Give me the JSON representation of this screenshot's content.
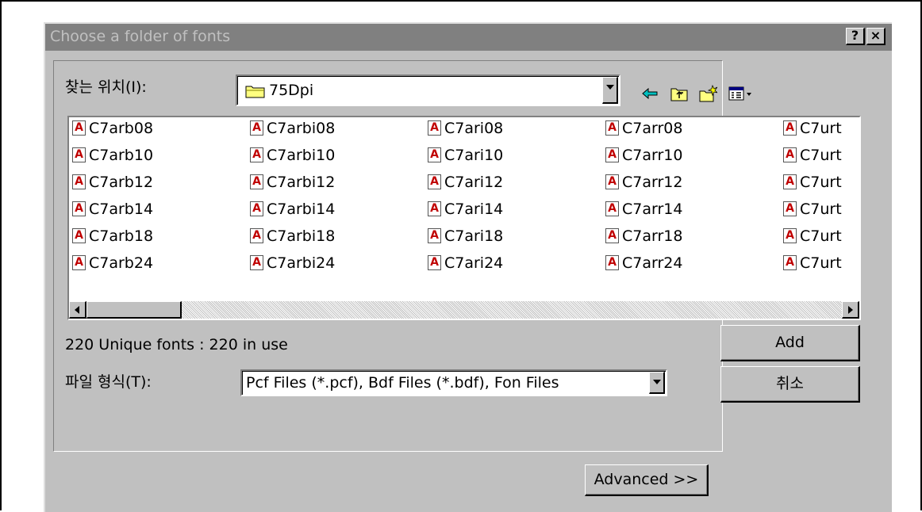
{
  "dialog": {
    "title": "Choose a folder of fonts",
    "help_label": "?",
    "close_label": "×"
  },
  "look_in": {
    "label": "찾는 위치(I):",
    "value": "75Dpi"
  },
  "toolbar": {
    "icons": [
      "back-icon",
      "up-folder-icon",
      "new-folder-icon",
      "view-menu-icon"
    ]
  },
  "files": {
    "col1": [
      "C7arb08",
      "C7arb10",
      "C7arb12",
      "C7arb14",
      "C7arb18",
      "C7arb24"
    ],
    "col2": [
      "C7arbi08",
      "C7arbi10",
      "C7arbi12",
      "C7arbi14",
      "C7arbi18",
      "C7arbi24"
    ],
    "col3": [
      "C7ari08",
      "C7ari10",
      "C7ari12",
      "C7ari14",
      "C7ari18",
      "C7ari24"
    ],
    "col4": [
      "C7arr08",
      "C7arr10",
      "C7arr12",
      "C7arr14",
      "C7arr18",
      "C7arr24"
    ],
    "col5": [
      "C7urt",
      "C7urt",
      "C7urt",
      "C7urt",
      "C7urt",
      "C7urt"
    ]
  },
  "status": {
    "text": "220 Unique fonts : 220 in use"
  },
  "file_type": {
    "label": "파일 형식(T):",
    "value": "Pcf Files (*.pcf), Bdf Files (*.bdf), Fon Files"
  },
  "buttons": {
    "add": "Add",
    "cancel": "취소",
    "advanced": "Advanced >>"
  },
  "colors": {
    "dialog_bg": "#c0c0c0",
    "titlebar_bg": "#808080",
    "file_icon": "#c00000"
  }
}
